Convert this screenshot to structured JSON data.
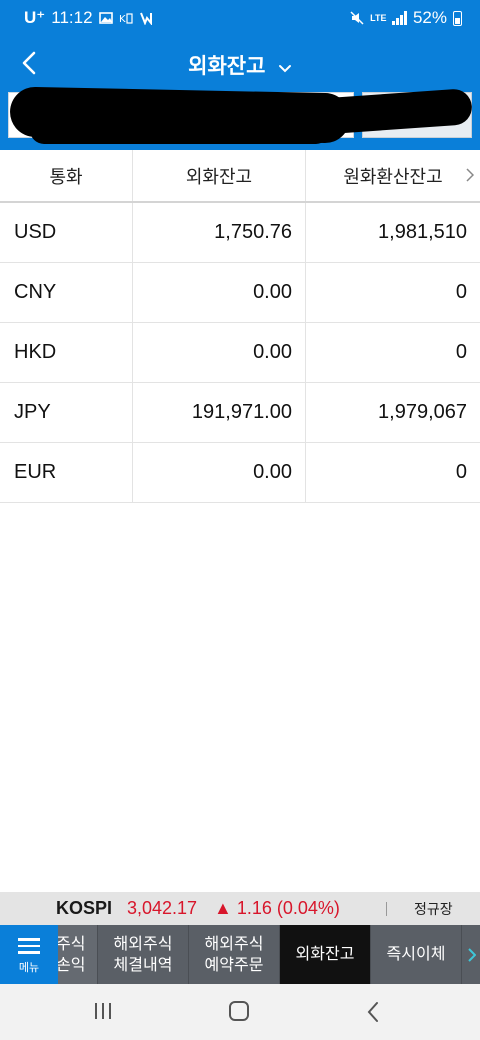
{
  "status_bar": {
    "carrier": "U⁺",
    "time": "11:12",
    "network": "LTE",
    "battery": "52%"
  },
  "header": {
    "title": "외화잔고"
  },
  "table": {
    "columns": [
      "통화",
      "외화잔고",
      "원화환산잔고"
    ],
    "rows": [
      {
        "currency": "USD",
        "fx_balance": "1,750.76",
        "krw_balance": "1,981,510"
      },
      {
        "currency": "CNY",
        "fx_balance": "0.00",
        "krw_balance": "0"
      },
      {
        "currency": "HKD",
        "fx_balance": "0.00",
        "krw_balance": "0"
      },
      {
        "currency": "JPY",
        "fx_balance": "191,971.00",
        "krw_balance": "1,979,067"
      },
      {
        "currency": "EUR",
        "fx_balance": "0.00",
        "krw_balance": "0"
      }
    ]
  },
  "ticker": {
    "index_name": "KOSPI",
    "value": "3,042.17",
    "change": "▲ 1.16 (0.04%)",
    "session": "정규장"
  },
  "tabbar": {
    "menu_label": "메뉴",
    "tabs": [
      {
        "line1": "주식",
        "line2": "손익"
      },
      {
        "line1": "해외주식",
        "line2": "체결내역"
      },
      {
        "line1": "해외주식",
        "line2": "예약주문"
      },
      {
        "line1": "외화잔고",
        "line2": ""
      },
      {
        "line1": "즉시이체",
        "line2": ""
      }
    ]
  },
  "colors": {
    "brand_blue": "#0a7fd9",
    "up_red": "#d8162b",
    "active_tab": "#111111",
    "next_arrow": "#3ec6d8"
  },
  "icons": [
    "back-arrow-icon",
    "chevron-down-icon",
    "chevron-right-icon",
    "hamburger-menu-icon",
    "battery-icon",
    "signal-icon"
  ]
}
